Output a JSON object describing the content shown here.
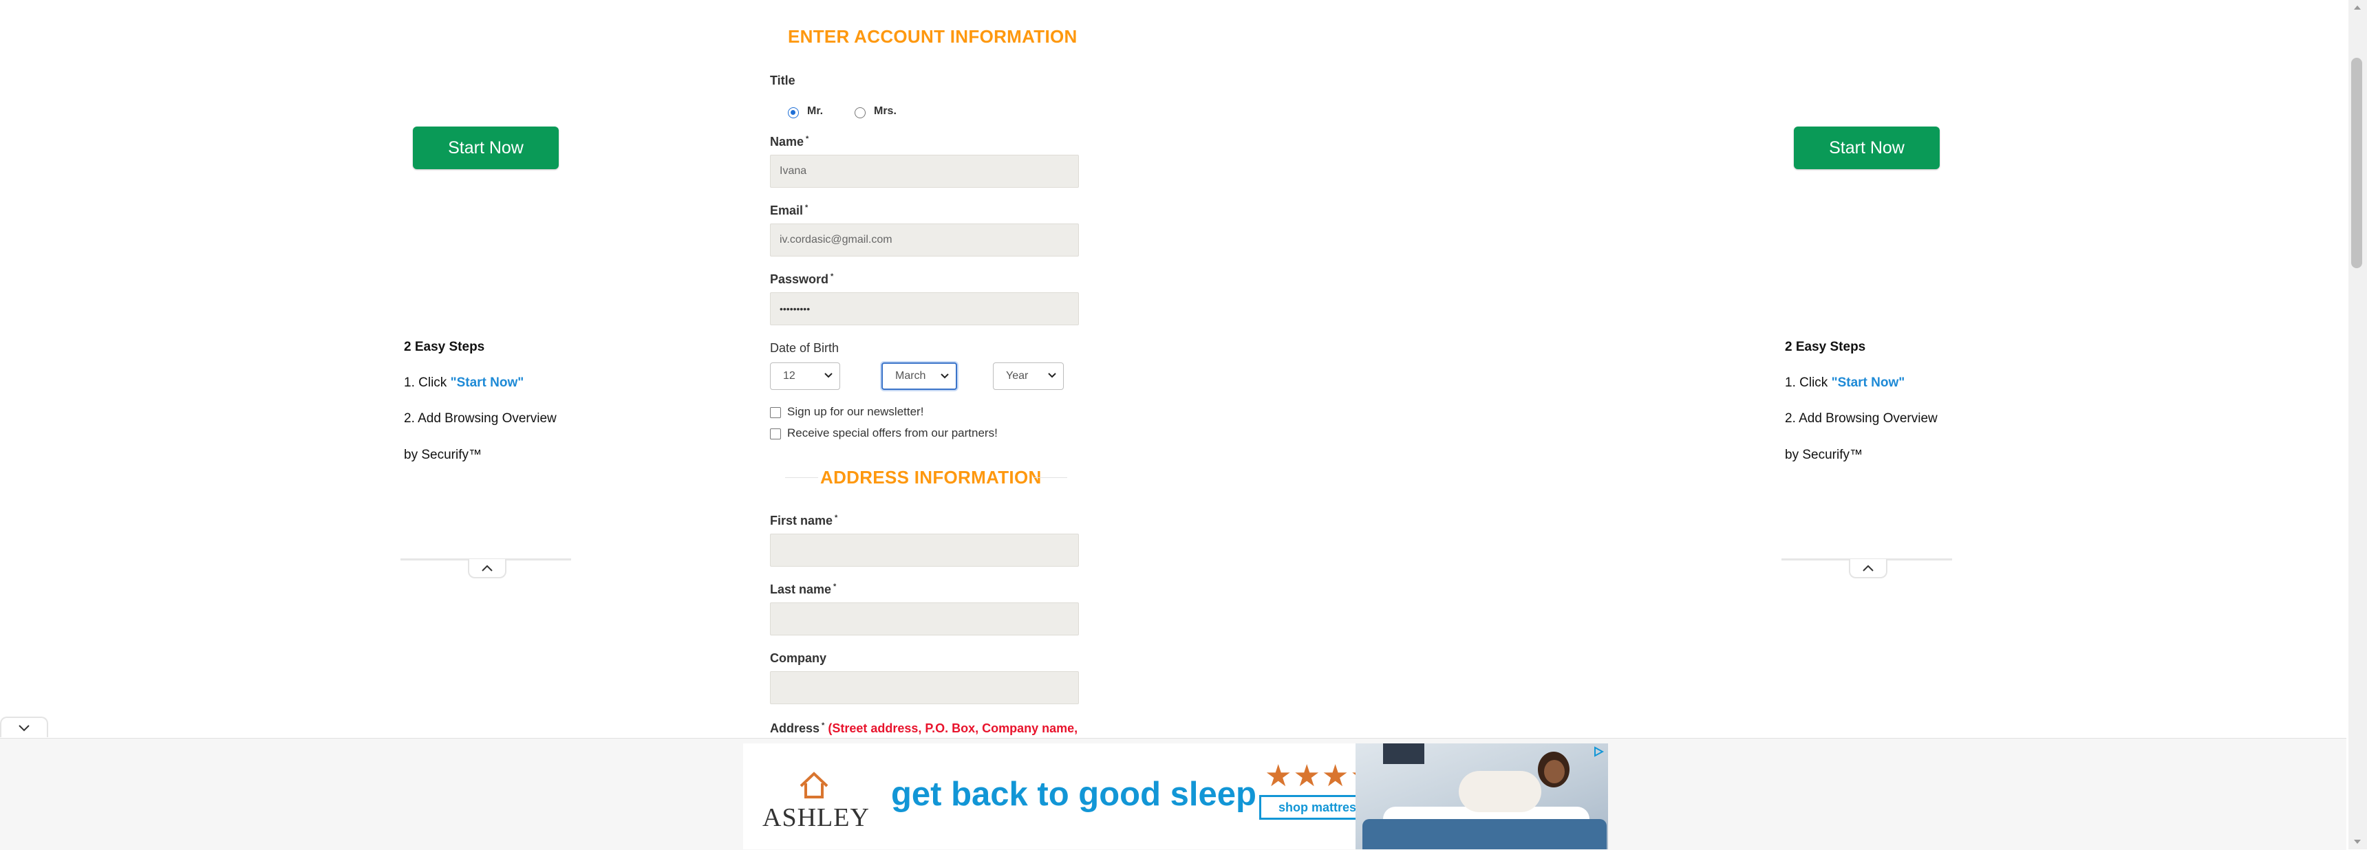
{
  "left_ad": {
    "button_label": "Start Now",
    "steps_title": "2 Easy Steps",
    "step1_prefix": "1. Click ",
    "step1_link": "\"Start Now\"",
    "step2": "2. Add Browsing Overview",
    "step2_line2": "by Securify™"
  },
  "right_ad": {
    "button_label": "Start Now",
    "steps_title": "2 Easy Steps",
    "step1_prefix": "1. Click ",
    "step1_link": "\"Start Now\"",
    "step2": "2. Add Browsing Overview",
    "step2_line2": "by Securify™"
  },
  "account": {
    "heading": "ENTER ACCOUNT INFORMATION",
    "title_label": "Title",
    "title_options": [
      "Mr.",
      "Mrs."
    ],
    "name_label": "Name",
    "name_value": "Ivana",
    "email_label": "Email",
    "email_value": "iv.cordasic@gmail.com",
    "password_label": "Password",
    "password_value": "•••••••••",
    "dob_label": "Date of Birth",
    "dob_day": "12",
    "dob_month": "March",
    "dob_year": "Year",
    "newsletter_label": "Sign up for our newsletter!",
    "offers_label": "Receive special offers from our partners!"
  },
  "address": {
    "heading": "ADDRESS INFORMATION",
    "first_name_label": "First name",
    "last_name_label": "Last name",
    "company_label": "Company",
    "address_label": "Address",
    "address_hint": "(Street address, P.O. Box, Company name,"
  },
  "required_marker": "*",
  "bottom_ad": {
    "brand": "ASHLEY",
    "headline": "get back to good sleep",
    "stars": "★★★★★",
    "cta": "shop mattresses →"
  },
  "colors": {
    "accent": "#fe980f",
    "start_button": "#0a9a57",
    "link": "#1e8ad6",
    "ad_blue": "#1296d6",
    "ad_orange": "#d9752f",
    "required_red": "#e8132c"
  }
}
